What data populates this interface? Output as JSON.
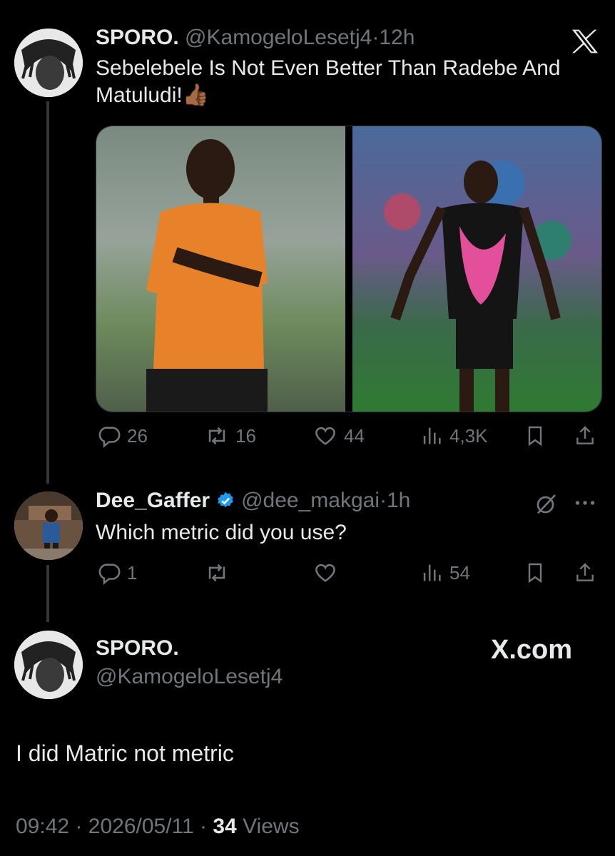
{
  "tweet": {
    "display_name": "SPORO.",
    "handle": "@KamogeloLesetj4",
    "time": "12h",
    "text_line1": "Sebelebele Is Not Even Better Than Radebe And",
    "text_line2": "Matuludi!",
    "emoji": "👍🏾",
    "stats": {
      "replies": "26",
      "retweets": "16",
      "likes": "44",
      "views": "4,3K"
    }
  },
  "reply": {
    "display_name": "Dee_Gaffer",
    "handle": "@dee_makgai",
    "time": "1h",
    "text": "Which metric did you use?",
    "stats": {
      "replies": "1",
      "views": "54"
    }
  },
  "main_reply": {
    "display_name": "SPORO.",
    "handle": "@KamogeloLesetj4",
    "brand": "X.com",
    "text": "I did Matric not metric",
    "time": "09:42",
    "date": "2026/05/11",
    "views_count": "34",
    "views_label": "Views"
  },
  "separator": "·",
  "colors": {
    "background": "#000000",
    "text": "#e7e9ea",
    "muted": "#71767b",
    "verified": "#1d9bf0"
  }
}
